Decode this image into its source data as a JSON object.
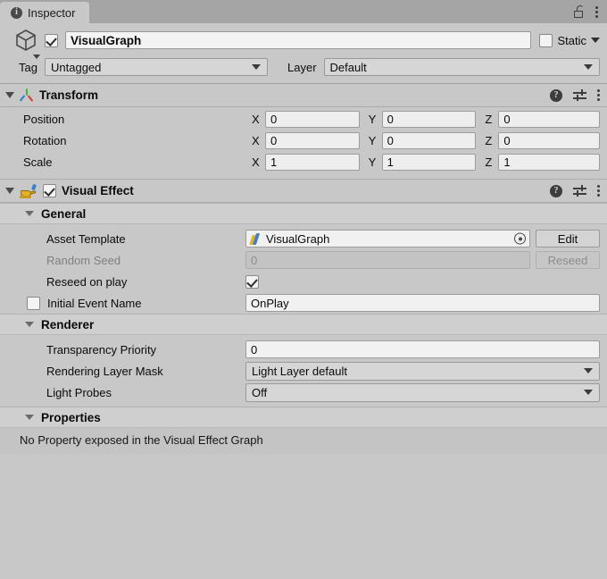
{
  "tab": {
    "label": "Inspector",
    "icon": "info-icon",
    "lock_icon": "lock-icon",
    "menu_icon": "kebab-menu-icon"
  },
  "gameobject": {
    "enabled": true,
    "name": "VisualGraph",
    "icon": "cube-icon",
    "static_label": "Static",
    "static_checked": false,
    "tag_label": "Tag",
    "tag_value": "Untagged",
    "layer_label": "Layer",
    "layer_value": "Default"
  },
  "transform": {
    "title": "Transform",
    "icon": "transform-axis-icon",
    "help_icon": "help-icon",
    "preset_icon": "preset-settings-icon",
    "menu_icon": "kebab-menu-icon",
    "rows": [
      {
        "label": "Position",
        "x": "0",
        "y": "0",
        "z": "0"
      },
      {
        "label": "Rotation",
        "x": "0",
        "y": "0",
        "z": "0"
      },
      {
        "label": "Scale",
        "x": "1",
        "y": "1",
        "z": "1"
      }
    ],
    "axes": [
      "X",
      "Y",
      "Z"
    ]
  },
  "visual_effect": {
    "title": "Visual Effect",
    "enabled": true,
    "icon": "vfx-lamp-icon",
    "help_icon": "help-icon",
    "preset_icon": "preset-settings-icon",
    "menu_icon": "kebab-menu-icon",
    "general": {
      "title": "General",
      "asset_template_label": "Asset Template",
      "asset_template_value": "VisualGraph",
      "asset_icon": "vfx-graph-asset-icon",
      "picker_icon": "object-picker-icon",
      "edit_button": "Edit",
      "random_seed_label": "Random Seed",
      "random_seed_value": "0",
      "random_seed_disabled": true,
      "reseed_button": "Reseed",
      "reseed_button_disabled": true,
      "reseed_on_play_label": "Reseed on play",
      "reseed_on_play_checked": true,
      "initial_event_name_label": "Initial Event Name",
      "initial_event_name_checked": false,
      "initial_event_name_value": "OnPlay"
    },
    "renderer": {
      "title": "Renderer",
      "transparency_priority_label": "Transparency Priority",
      "transparency_priority_value": "0",
      "rendering_layer_mask_label": "Rendering Layer Mask",
      "rendering_layer_mask_value": "Light Layer default",
      "light_probes_label": "Light Probes",
      "light_probes_value": "Off"
    },
    "properties": {
      "title": "Properties",
      "empty_message": "No Property exposed in the Visual Effect Graph"
    }
  },
  "colors": {
    "window_bg": "#c8c8c8",
    "toolbar_bg": "#a5a5a5",
    "section_bg": "#cfcfcf",
    "field_bg": "#f1f1f1",
    "properties_bg": "#c4c4c4"
  }
}
